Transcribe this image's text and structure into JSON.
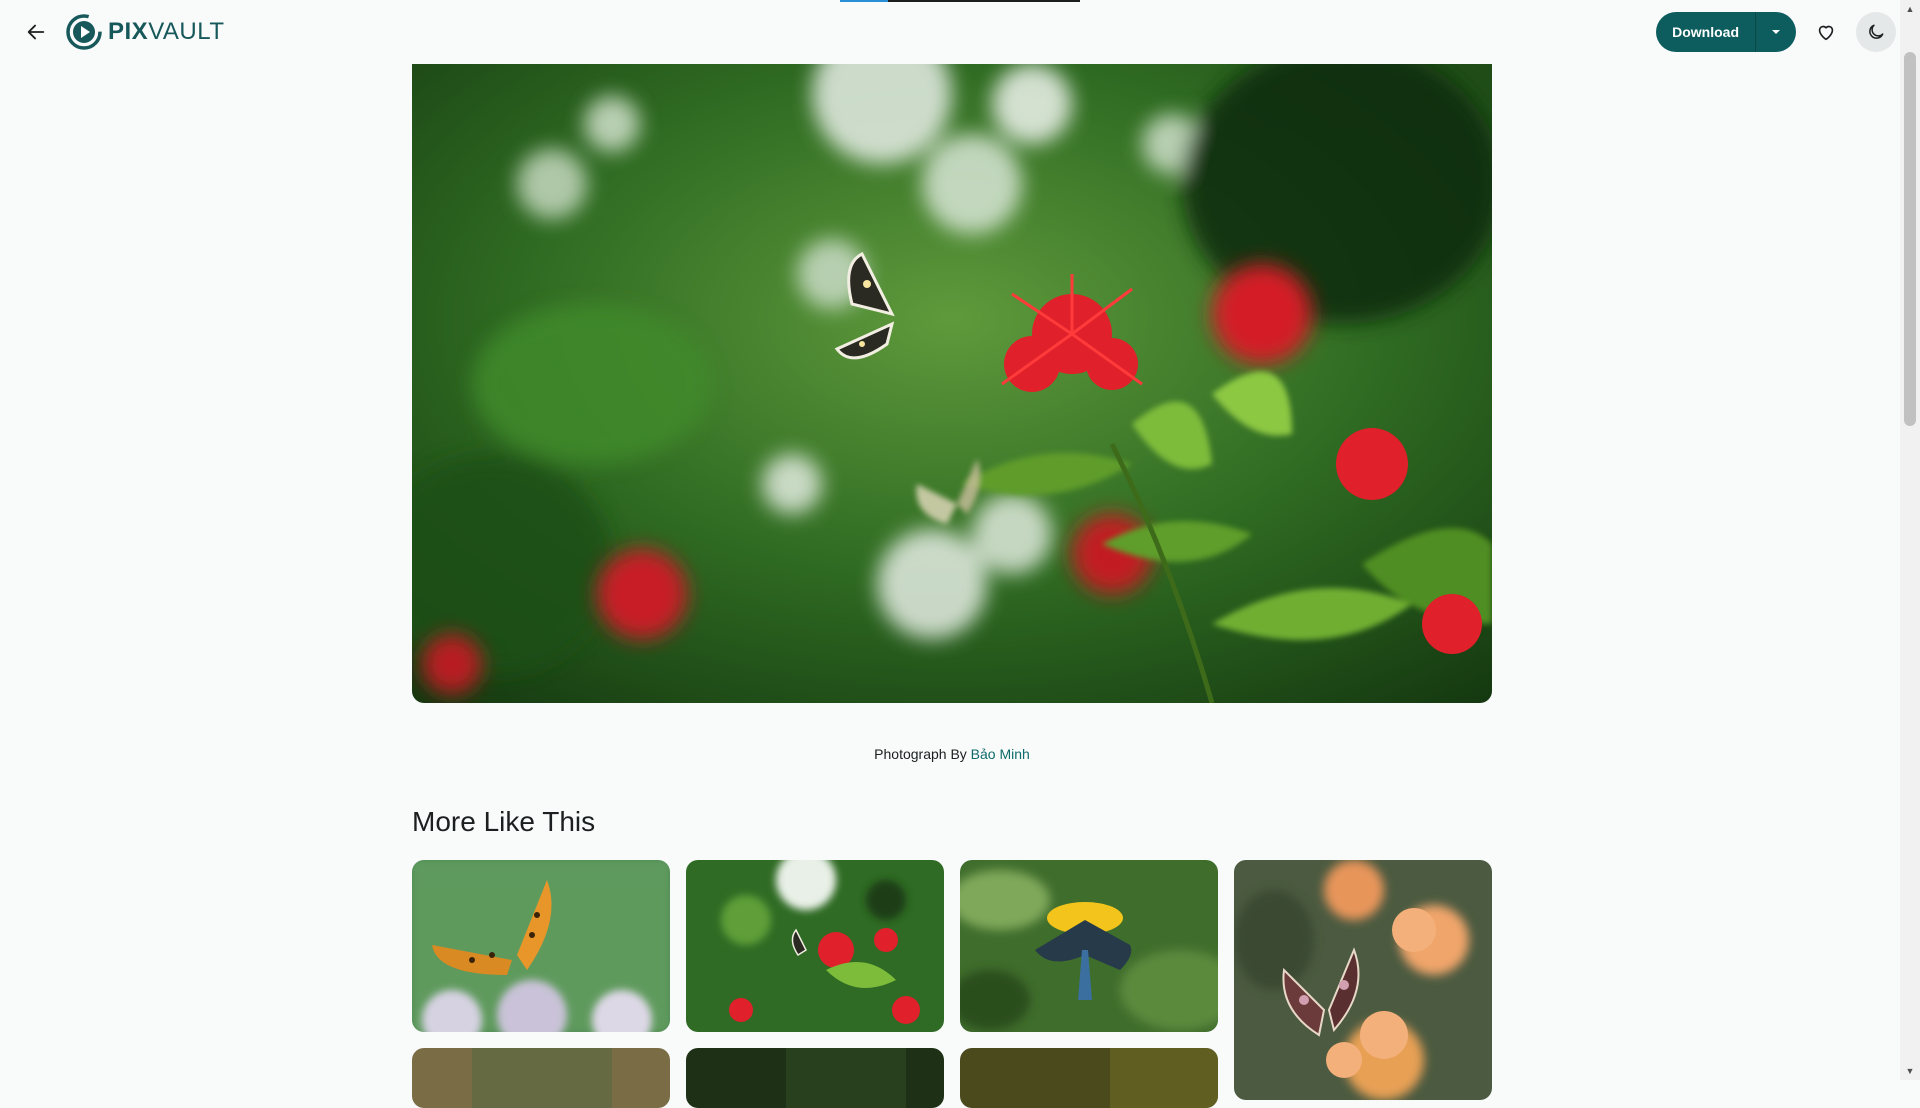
{
  "header": {
    "logo_bold": "PIX",
    "logo_light": "VAULT",
    "download_label": "Download"
  },
  "credit": {
    "prefix": "Photograph By",
    "author": "Bảo Minh"
  },
  "section": {
    "title": "More Like This"
  },
  "hero": {
    "subject": "butterfly on red ixora flowers"
  },
  "thumbnails": [
    {
      "subject": "orange butterfly on white flowers"
    },
    {
      "subject": "butterfly on red ixora flowers"
    },
    {
      "subject": "dark blue butterfly on yellow flower"
    },
    {
      "subject": "brown butterfly on orange lantana"
    },
    {
      "subject": "partial thumbnail"
    },
    {
      "subject": "partial thumbnail"
    },
    {
      "subject": "partial thumbnail"
    }
  ],
  "colors": {
    "brand": "#0d5d5e",
    "link": "#0f6a6c",
    "background": "#f9fbfb"
  },
  "icons": [
    "back-arrow-icon",
    "pixvault-logo-icon",
    "chevron-down-icon",
    "heart-icon",
    "moon-icon"
  ]
}
